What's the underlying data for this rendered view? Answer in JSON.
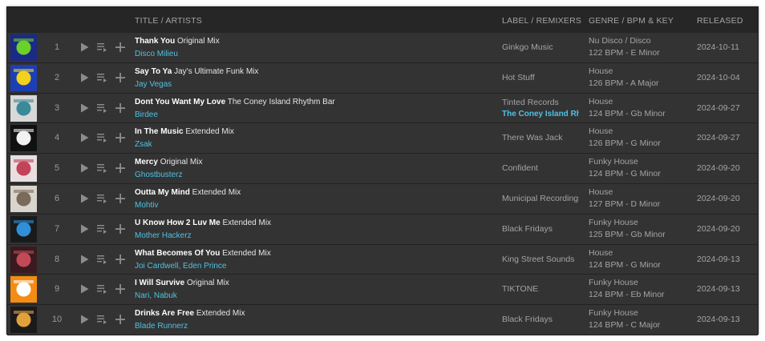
{
  "header": {
    "title_artists": "TITLE / ARTISTS",
    "label_remixers": "LABEL / REMIXERS",
    "genre_bpm_key": "GENRE / BPM & KEY",
    "released": "RELEASED"
  },
  "icons": {
    "play": "play-icon",
    "queue": "add-to-queue-icon",
    "add": "plus-icon"
  },
  "colors": {
    "panel": "#262626",
    "row": "#333333",
    "accent": "#4ec2e4",
    "muted": "#a4a4a4"
  },
  "tracks": [
    {
      "num": "1",
      "title": "Thank You",
      "mix": "Original Mix",
      "artists": "Disco Milieu",
      "label": "Ginkgo Music",
      "remixers": "",
      "genre": "Nu Disco / Disco",
      "bpm_key": "122 BPM - E Minor",
      "released": "2024-10-11",
      "art_colors": [
        "#1a2a86",
        "#6bd12a"
      ]
    },
    {
      "num": "2",
      "title": "Say To Ya",
      "mix": "Jay's Ultimate Funk Mix",
      "artists": "Jay Vegas",
      "label": "Hot Stuff",
      "remixers": "",
      "genre": "House",
      "bpm_key": "126 BPM - A Major",
      "released": "2024-10-04",
      "art_colors": [
        "#1d3fb5",
        "#f2d21d"
      ]
    },
    {
      "num": "3",
      "title": "Dont You Want My Love",
      "mix": "The Coney Island Rhythm Bar",
      "artists": "Birdee",
      "label": "Tinted Records",
      "remixers": "The Coney Island Rhythm",
      "genre": "House",
      "bpm_key": "124 BPM - Gb Minor",
      "released": "2024-09-27",
      "art_colors": [
        "#d8d8d8",
        "#3a8a9a"
      ]
    },
    {
      "num": "4",
      "title": "In The Music",
      "mix": "Extended Mix",
      "artists": "Zsak",
      "label": "There Was Jack",
      "remixers": "",
      "genre": "House",
      "bpm_key": "126 BPM - G Minor",
      "released": "2024-09-27",
      "art_colors": [
        "#111111",
        "#f2f2f2"
      ]
    },
    {
      "num": "5",
      "title": "Mercy",
      "mix": "Original Mix",
      "artists": "Ghostbusterz",
      "label": "Confident",
      "remixers": "",
      "genre": "Funky House",
      "bpm_key": "124 BPM - G Minor",
      "released": "2024-09-20",
      "art_colors": [
        "#e9dfe0",
        "#c2435a"
      ]
    },
    {
      "num": "6",
      "title": "Outta My Mind",
      "mix": "Extended Mix",
      "artists": "Mohtiv",
      "label": "Municipal Recordings",
      "remixers": "",
      "genre": "House",
      "bpm_key": "127 BPM - D Minor",
      "released": "2024-09-20",
      "art_colors": [
        "#d9d4cc",
        "#7a6a5a"
      ]
    },
    {
      "num": "7",
      "title": "U Know How 2 Luv Me",
      "mix": "Extended Mix",
      "artists": "Mother Hackerz",
      "label": "Black Fridays",
      "remixers": "",
      "genre": "Funky House",
      "bpm_key": "125 BPM - Gb Minor",
      "released": "2024-09-20",
      "art_colors": [
        "#1a1a1a",
        "#2f8fd8"
      ]
    },
    {
      "num": "8",
      "title": "What Becomes Of You",
      "mix": "Extended Mix",
      "artists": "Joi Cardwell, Eden Prince",
      "label": "King Street Sounds",
      "remixers": "",
      "genre": "House",
      "bpm_key": "124 BPM - G Minor",
      "released": "2024-09-13",
      "art_colors": [
        "#3a1a1e",
        "#c24a56"
      ]
    },
    {
      "num": "9",
      "title": "I Will Survive",
      "mix": "Original Mix",
      "artists": "Nari, Nabuk",
      "label": "TIKTONE",
      "remixers": "",
      "genre": "Funky House",
      "bpm_key": "124 BPM - Eb Minor",
      "released": "2024-09-13",
      "art_colors": [
        "#f28c14",
        "#ffffff"
      ]
    },
    {
      "num": "10",
      "title": "Drinks Are Free",
      "mix": "Extended Mix",
      "artists": "Blade Runnerz",
      "label": "Black Fridays",
      "remixers": "",
      "genre": "Funky House",
      "bpm_key": "124 BPM - C Major",
      "released": "2024-09-13",
      "art_colors": [
        "#1a1a1a",
        "#e2a13a"
      ]
    }
  ]
}
